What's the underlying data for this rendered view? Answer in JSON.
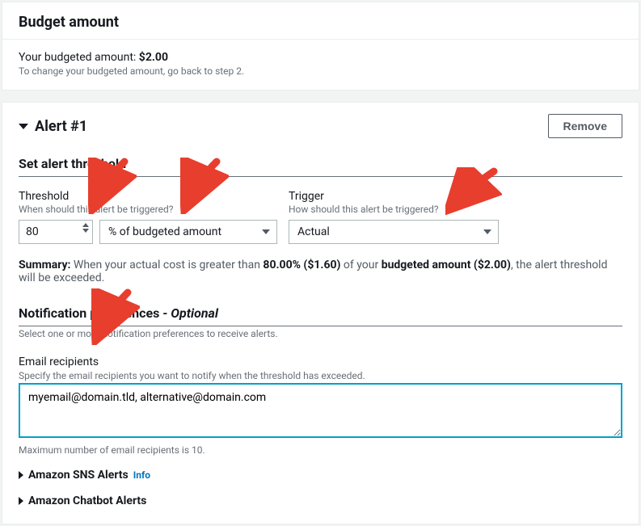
{
  "budget": {
    "title": "Budget amount",
    "line_prefix": "Your budgeted amount: ",
    "amount": "$2.00",
    "hint": "To change your budgeted amount, go back to step 2."
  },
  "alert": {
    "title": "Alert #1",
    "remove_label": "Remove",
    "threshold_section": "Set alert threshold",
    "threshold_label": "Threshold",
    "threshold_help": "When should this alert be triggered?",
    "threshold_value": "80",
    "threshold_unit": "% of budgeted amount",
    "trigger_label": "Trigger",
    "trigger_help": "How should this alert be triggered?",
    "trigger_value": "Actual",
    "summary_prefix": "Summary:",
    "summary_text_a": " When your actual cost is greater than ",
    "summary_pct": "80.00% ($1.60)",
    "summary_text_b": " of your ",
    "summary_budget_label": "budgeted amount ($2.00)",
    "summary_text_c": ", the alert threshold will be exceeded."
  },
  "notif": {
    "section_title": "Notification preferences",
    "optional": " - Optional",
    "section_help": "Select one or more notification preferences to receive alerts.",
    "email_label": "Email recipients",
    "email_help": "Specify the email recipients you want to notify when the threshold has exceeded.",
    "email_value": "myemail@domain.tld, alternative@domain.com",
    "max_note": "Maximum number of email recipients is 10.",
    "sns_label": "Amazon SNS Alerts",
    "info": "Info",
    "chatbot_label": "Amazon Chatbot Alerts"
  }
}
